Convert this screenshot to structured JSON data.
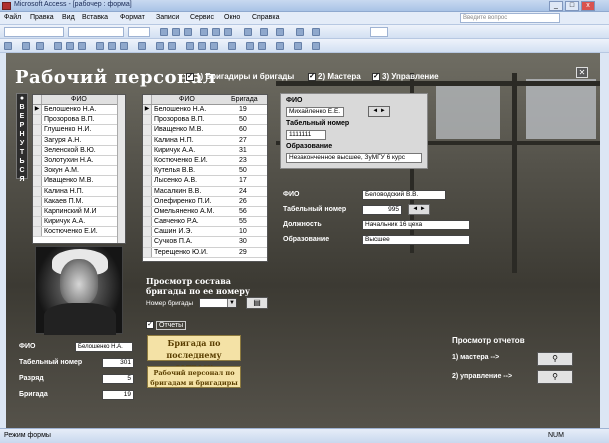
{
  "window": {
    "title": "Microsoft Access - [рабочер : форма]"
  },
  "menu": {
    "items": [
      "Файл",
      "Правка",
      "Вид",
      "Вставка",
      "Формат",
      "Записи",
      "Сервис",
      "Окно",
      "Справка"
    ],
    "help_placeholder": "Введите вопрос"
  },
  "form": {
    "header": "Рабочий персонал",
    "options": [
      {
        "label": "1) Бригадиры и бригады",
        "checked": true
      },
      {
        "label": "2) Мастера",
        "checked": true
      },
      {
        "label": "3) Управление",
        "checked": true
      }
    ],
    "close_label": "✕",
    "vertical_button": "ВЕРНУТЬСЯ",
    "grid_left": {
      "column": "ФИО",
      "rows": [
        "Белошенко Н.А.",
        "Прозорова В.П.",
        "Глушенко Н.И.",
        "Загуря А.Н.",
        "Зеленской В.Ю.",
        "Золотухин Н.А.",
        "Зокун А.М.",
        "Иващенко М.В.",
        "Калина Н.П.",
        "Какаев П.М.",
        "Карпинский М.И",
        "Киричук А.А.",
        "Костюченко Е.И."
      ]
    },
    "grid_right": {
      "columns": [
        "ФИО",
        "Бригада"
      ],
      "rows": [
        [
          "Белошенко Н.А.",
          "19"
        ],
        [
          "Прозорова В.П.",
          "50"
        ],
        [
          "Иващенко М.В.",
          "60"
        ],
        [
          "Калина Н.П.",
          "27"
        ],
        [
          "Киричук А.А.",
          "31"
        ],
        [
          "Костюченко Е.И.",
          "23"
        ],
        [
          "Кутелья В.В.",
          "50"
        ],
        [
          "Лысенко А.В.",
          "17"
        ],
        [
          "Масалкин В.В.",
          "24"
        ],
        [
          "Олефиренко П.И.",
          "26"
        ],
        [
          "Омельяненко А.М.",
          "56"
        ],
        [
          "Савченко Р.А.",
          "55"
        ],
        [
          "Сашин И.Э.",
          "10"
        ],
        [
          "Сучков П.А.",
          "30"
        ],
        [
          "Терещенко Ю.И.",
          "29"
        ]
      ]
    },
    "master_panel": {
      "fio_label": "ФИО",
      "fio_value": "Михайленко Е.Е.",
      "tab_label": "Табельный номер",
      "tab_value": "1111111",
      "edu_label": "Образование",
      "edu_value": "Незаконченное высшее, ЗуМГУ 6 курс"
    },
    "mgmt_panel": {
      "fio_label": "ФИО",
      "fio_value": "Беловодский В.В.",
      "tab_label": "Табельный номер",
      "tab_value": "995",
      "pos_label": "Должность",
      "pos_value": "Начальник 16 цеха",
      "edu_label": "Образование",
      "edu_value": "Высшее"
    },
    "brigade_view": {
      "title": "Просмотр состава бригады по ее номеру",
      "label": "Номер бригады"
    },
    "reports_checkbox": {
      "label": "Отчеты",
      "checked": true
    },
    "btn_last_request": "Бригада по последнему запросу",
    "btn_staff_by_brigades": "Рабочий персонал по бригадам и бригадиры",
    "worker": {
      "fio_label": "ФИО",
      "fio_value": "Белошенко Н.А.",
      "tab_label": "Табельный номер",
      "tab_value": "301",
      "rank_label": "Разряд",
      "rank_value": "5",
      "brigade_label": "Бригада",
      "brigade_value": "19"
    },
    "reports": {
      "title": "Просмотр отчетов",
      "item1": "1) мастера",
      "item2": "2) управление",
      "arrow": "-->"
    }
  },
  "statusbar": {
    "left": "Режим формы",
    "right": "NUM"
  }
}
